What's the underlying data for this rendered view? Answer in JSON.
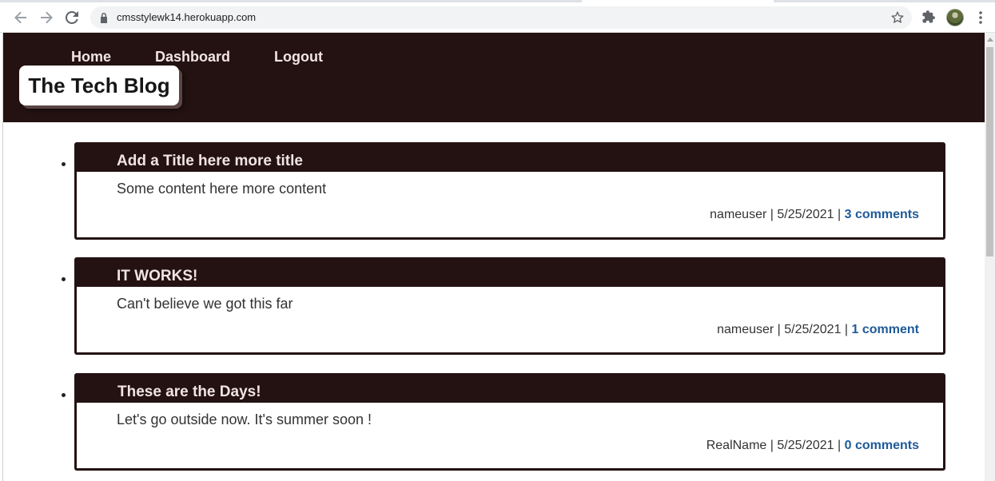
{
  "browser": {
    "url": "cmsstylewk14.herokuapp.com",
    "icons": [
      "back-arrow-icon",
      "forward-arrow-icon",
      "reload-icon",
      "lock-icon",
      "star-icon",
      "puzzle-icon",
      "avatar",
      "kebab-menu-icon"
    ]
  },
  "site": {
    "brand": "The Tech Blog",
    "nav": {
      "home": "Home",
      "dashboard": "Dashboard",
      "logout": "Logout"
    }
  },
  "posts": [
    {
      "title": "Add a Title here more title",
      "content": "Some content here more content",
      "author": "nameuser",
      "date": "5/25/2021",
      "separator": "|",
      "comments": "3 comments"
    },
    {
      "title": "IT WORKS!",
      "content": "Can't believe we got this far",
      "author": "nameuser",
      "date": "5/25/2021",
      "separator": "|",
      "comments": "1 comment"
    },
    {
      "title": "These are the Days!",
      "content": "Let's go outside now. It's summer soon !",
      "author": "RealName",
      "date": "5/25/2021",
      "separator": "|",
      "comments": "0 comments"
    }
  ],
  "colors": {
    "header_bg": "#241212",
    "header_text": "#f1e4e4",
    "link": "#1e5a99"
  }
}
